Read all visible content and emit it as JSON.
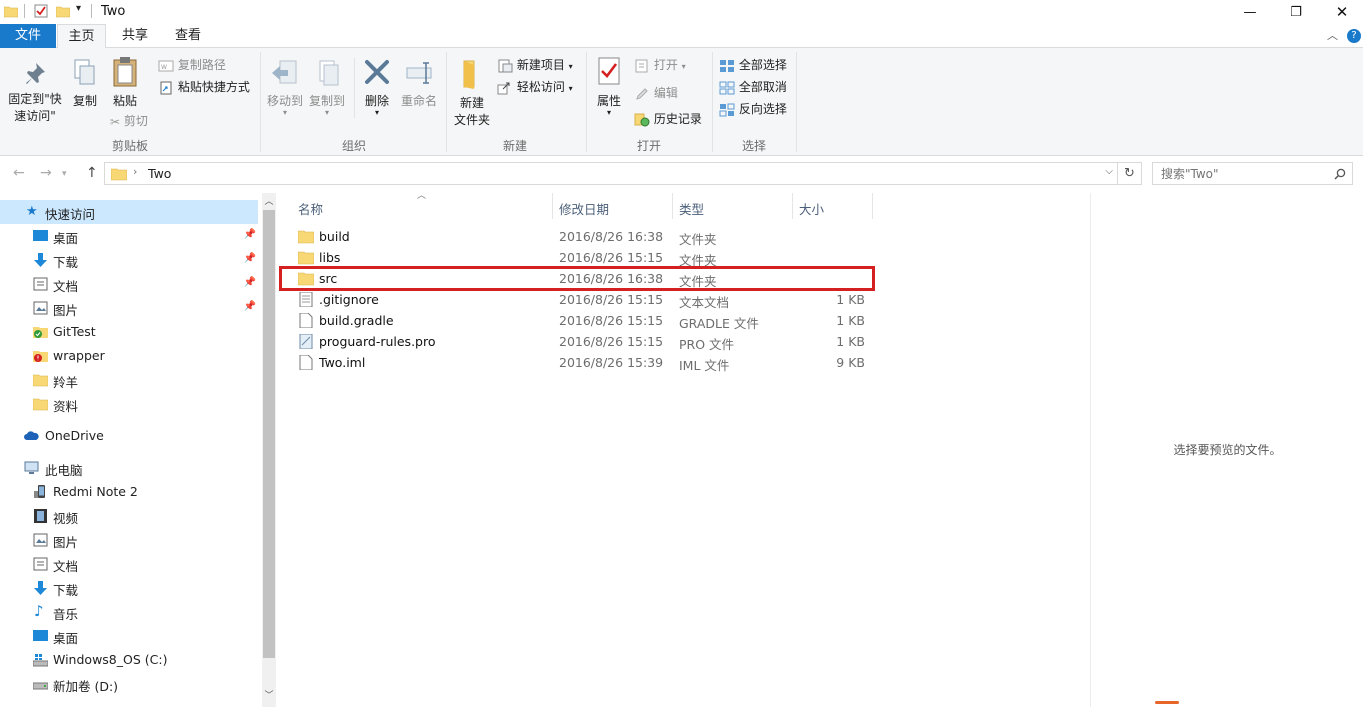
{
  "window": {
    "title": "Two",
    "help": "?"
  },
  "tabs": [
    "文件",
    "主页",
    "共享",
    "查看"
  ],
  "ribbon": {
    "clipboard": {
      "pin": "固定到\"快\n速访问\"",
      "pin_l1": "固定到\"快",
      "pin_l2": "速访问\"",
      "copy": "复制",
      "paste": "粘贴",
      "copy_path": "复制路径",
      "paste_shortcut": "粘贴快捷方式",
      "cut": "剪切",
      "label": "剪贴板"
    },
    "organize": {
      "move_to": "移动到",
      "copy_to": "复制到",
      "delete": "删除",
      "rename": "重命名",
      "label": "组织"
    },
    "new": {
      "new_folder_l1": "新建",
      "new_folder_l2": "文件夹",
      "new_item": "新建项目",
      "easy_access": "轻松访问",
      "label": "新建"
    },
    "open": {
      "properties": "属性",
      "open": "打开",
      "edit": "编辑",
      "history": "历史记录",
      "label": "打开"
    },
    "select": {
      "select_all": "全部选择",
      "select_none": "全部取消",
      "invert": "反向选择",
      "label": "选择"
    }
  },
  "address": {
    "path": "Two",
    "search_placeholder": "搜索\"Two\""
  },
  "nav": {
    "quick_access": "快速访问",
    "quick_items": [
      "桌面",
      "下载",
      "文档",
      "图片",
      "GitTest",
      "wrapper",
      "羚羊",
      "资料"
    ],
    "onedrive": "OneDrive",
    "this_pc": "此电脑",
    "pc_items": [
      "Redmi Note 2",
      "视频",
      "图片",
      "文档",
      "下载",
      "音乐",
      "桌面",
      "Windows8_OS (C:)",
      "新加卷 (D:)"
    ]
  },
  "columns": {
    "name": "名称",
    "date": "修改日期",
    "type": "类型",
    "size": "大小"
  },
  "files": [
    {
      "name": "build",
      "date": "2016/8/26 16:38",
      "type": "文件夹",
      "size": "",
      "icon": "folder-icon"
    },
    {
      "name": "libs",
      "date": "2016/8/26 15:15",
      "type": "文件夹",
      "size": "",
      "icon": "folder-icon"
    },
    {
      "name": "src",
      "date": "2016/8/26 16:38",
      "type": "文件夹",
      "size": "",
      "icon": "folder-icon"
    },
    {
      "name": ".gitignore",
      "date": "2016/8/26 15:15",
      "type": "文本文档",
      "size": "1 KB",
      "icon": "text-file-icon"
    },
    {
      "name": "build.gradle",
      "date": "2016/8/26 15:15",
      "type": "GRADLE 文件",
      "size": "1 KB",
      "icon": "file-icon"
    },
    {
      "name": "proguard-rules.pro",
      "date": "2016/8/26 15:15",
      "type": "PRO 文件",
      "size": "1 KB",
      "icon": "pro-file-icon"
    },
    {
      "name": "Two.iml",
      "date": "2016/8/26 15:39",
      "type": "IML 文件",
      "size": "9 KB",
      "icon": "file-icon"
    }
  ],
  "preview": {
    "message": "选择要预览的文件。"
  }
}
